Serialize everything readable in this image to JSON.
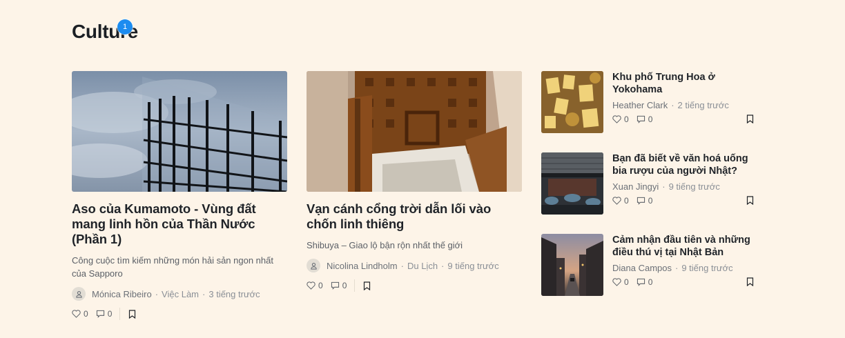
{
  "section": {
    "title": "Culture",
    "badge": "1"
  },
  "featured": [
    {
      "title": "Aso của Kumamoto - Vùng đất mang linh hồn của Thần Nước (Phần 1)",
      "excerpt": "Công cuộc tìm kiếm những món hải sản ngon nhất của Sapporo",
      "author": "Mónica Ribeiro",
      "category": "Việc Làm",
      "time": "3 tiếng trước",
      "likes": "0",
      "comments": "0"
    },
    {
      "title": "Vạn cánh cổng trời dẫn lối vào chốn linh thiêng",
      "excerpt": "Shibuya – Giao lộ bận rộn nhất thế giới",
      "author": "Nicolina Lindholm",
      "category": "Du Lịch",
      "time": "9 tiếng trước",
      "likes": "0",
      "comments": "0"
    }
  ],
  "side": [
    {
      "title": "Khu phố Trung Hoa ở Yokohama",
      "author": "Heather Clark",
      "time": "2 tiếng trước",
      "likes": "0",
      "comments": "0"
    },
    {
      "title": "Bạn đã biết về văn hoá uống bia rượu của người Nhật?",
      "author": "Xuan Jingyi",
      "time": "9 tiếng trước",
      "likes": "0",
      "comments": "0"
    },
    {
      "title": "Cảm nhận đầu tiên và những điều thú vị tại Nhật Bản",
      "author": "Diana Campos",
      "time": "9 tiếng trước",
      "likes": "0",
      "comments": "0"
    }
  ],
  "meta_separator": "·",
  "icons": {
    "like": "heart-icon",
    "comment": "comment-icon",
    "bookmark": "bookmark-icon",
    "avatar": "user-icon"
  },
  "colors": {
    "background": "#fdf4e8",
    "badge": "#1c8cf0",
    "text": "#1f2328",
    "muted": "#8a8f96"
  }
}
